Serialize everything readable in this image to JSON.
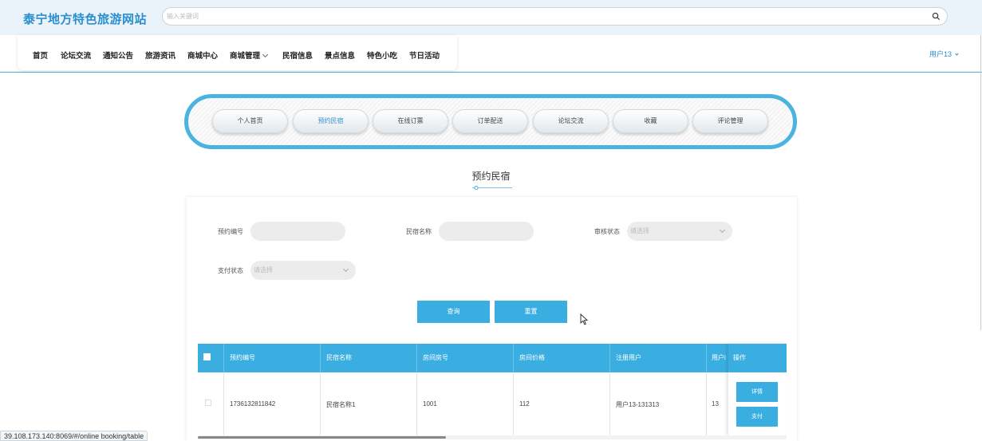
{
  "header": {
    "site_title": "泰宁地方特色旅游网站",
    "search_placeholder": "输入关键词",
    "user_label": "用户13"
  },
  "nav": {
    "items": [
      "首页",
      "论坛交流",
      "通知公告",
      "旅游资讯",
      "商城中心",
      "商城管理",
      "民宿信息",
      "景点信息",
      "特色小吃",
      "节日活动"
    ]
  },
  "tabs": {
    "items": [
      "个人首页",
      "预约民宿",
      "在线订票",
      "订单配送",
      "论坛交流",
      "收藏",
      "评论管理"
    ],
    "active_index": 1
  },
  "page": {
    "title": "预约民宿"
  },
  "filters": {
    "booking_no_label": "预约编号",
    "homestay_name_label": "民宿名称",
    "review_status_label": "审核状态",
    "review_status_value": "请选择",
    "pay_status_label": "支付状态",
    "pay_status_value": "请选择",
    "query_button": "查询",
    "reset_button": "重置"
  },
  "table": {
    "columns": [
      "预约编号",
      "民宿名称",
      "房间房号",
      "房间价格",
      "注册用户",
      "用户l",
      "操作"
    ],
    "rows": [
      {
        "booking_no": "1736132811842",
        "homestay_name": "民宿名称1",
        "room_no": "1001",
        "price": "112",
        "user": "用户13-131313",
        "user_short": "13",
        "actions": [
          "详情",
          "支付"
        ]
      }
    ]
  },
  "status_bar": {
    "url": "39.108.173.140:8069/#/online booking/table"
  },
  "colors": {
    "brand_blue": "#2b8fcf",
    "accent": "#3aaee0",
    "frame": "#4ab3e0"
  }
}
